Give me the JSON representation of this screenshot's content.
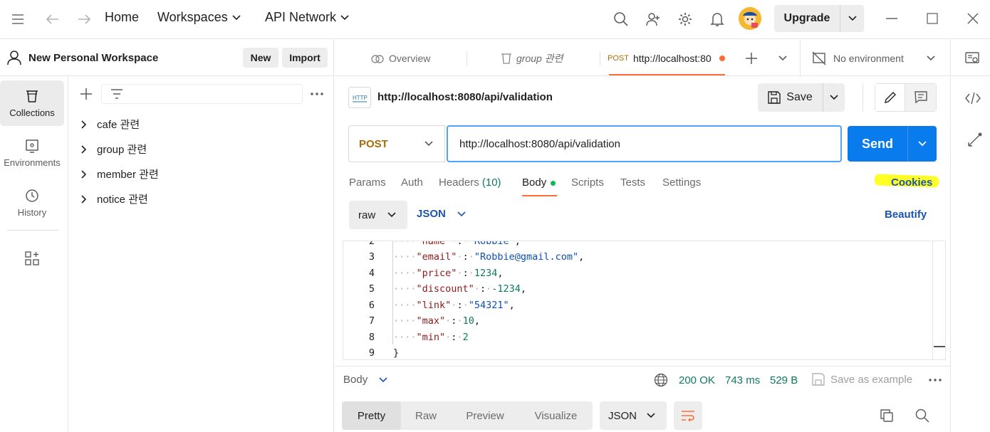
{
  "topbar": {
    "home": "Home",
    "workspaces": "Workspaces",
    "api_network": "API Network",
    "upgrade": "Upgrade"
  },
  "workspace": {
    "name": "New Personal Workspace",
    "new_label": "New",
    "import_label": "Import"
  },
  "rail": {
    "collections": "Collections",
    "environments": "Environments",
    "history": "History"
  },
  "collections": [
    {
      "label": "cafe 관련"
    },
    {
      "label": "group 관련"
    },
    {
      "label": "member 관련"
    },
    {
      "label": "notice 관련"
    }
  ],
  "tabs": {
    "overview": "Overview",
    "group": "group 관련",
    "active_method": "POST",
    "active_url": "http://localhost:80",
    "environment": "No environment"
  },
  "request": {
    "title": "http://localhost:8080/api/validation",
    "save_label": "Save",
    "method": "POST",
    "url": "http://localhost:8080/api/validation",
    "send_label": "Send",
    "tabs": {
      "params": "Params",
      "auth": "Auth",
      "headers": "Headers",
      "headers_count": "(10)",
      "body": "Body",
      "scripts": "Scripts",
      "tests": "Tests",
      "settings": "Settings"
    },
    "cookies": "Cookies",
    "body_mode": "raw",
    "body_lang": "JSON",
    "beautify": "Beautify"
  },
  "editor": {
    "line_numbers": [
      "2",
      "3",
      "4",
      "5",
      "6",
      "7",
      "8",
      "9"
    ],
    "lines": [
      {
        "key": "\"name\"",
        "val": "\"Robbie\""
      },
      {
        "key": "\"email\"",
        "val": "\"Robbie@gmail.com\""
      },
      {
        "key": "\"price\"",
        "val": "1234"
      },
      {
        "key": "\"discount\"",
        "val": "-1234"
      },
      {
        "key": "\"link\"",
        "val": "\"54321\""
      },
      {
        "key": "\"max\"",
        "val": "10"
      },
      {
        "key": "\"min\"",
        "val": "2"
      }
    ],
    "closing": "}"
  },
  "response": {
    "label": "Body",
    "status": "200 OK",
    "time": "743 ms",
    "size": "529 B",
    "save_example": "Save as example",
    "views": {
      "pretty": "Pretty",
      "raw": "Raw",
      "preview": "Preview",
      "visualize": "Visualize"
    },
    "format": "JSON"
  },
  "colors": {
    "accent_orange": "#ff6c37",
    "send_blue": "#097bed",
    "status_green": "#0d7a5f",
    "highlight": "#ffff00"
  }
}
